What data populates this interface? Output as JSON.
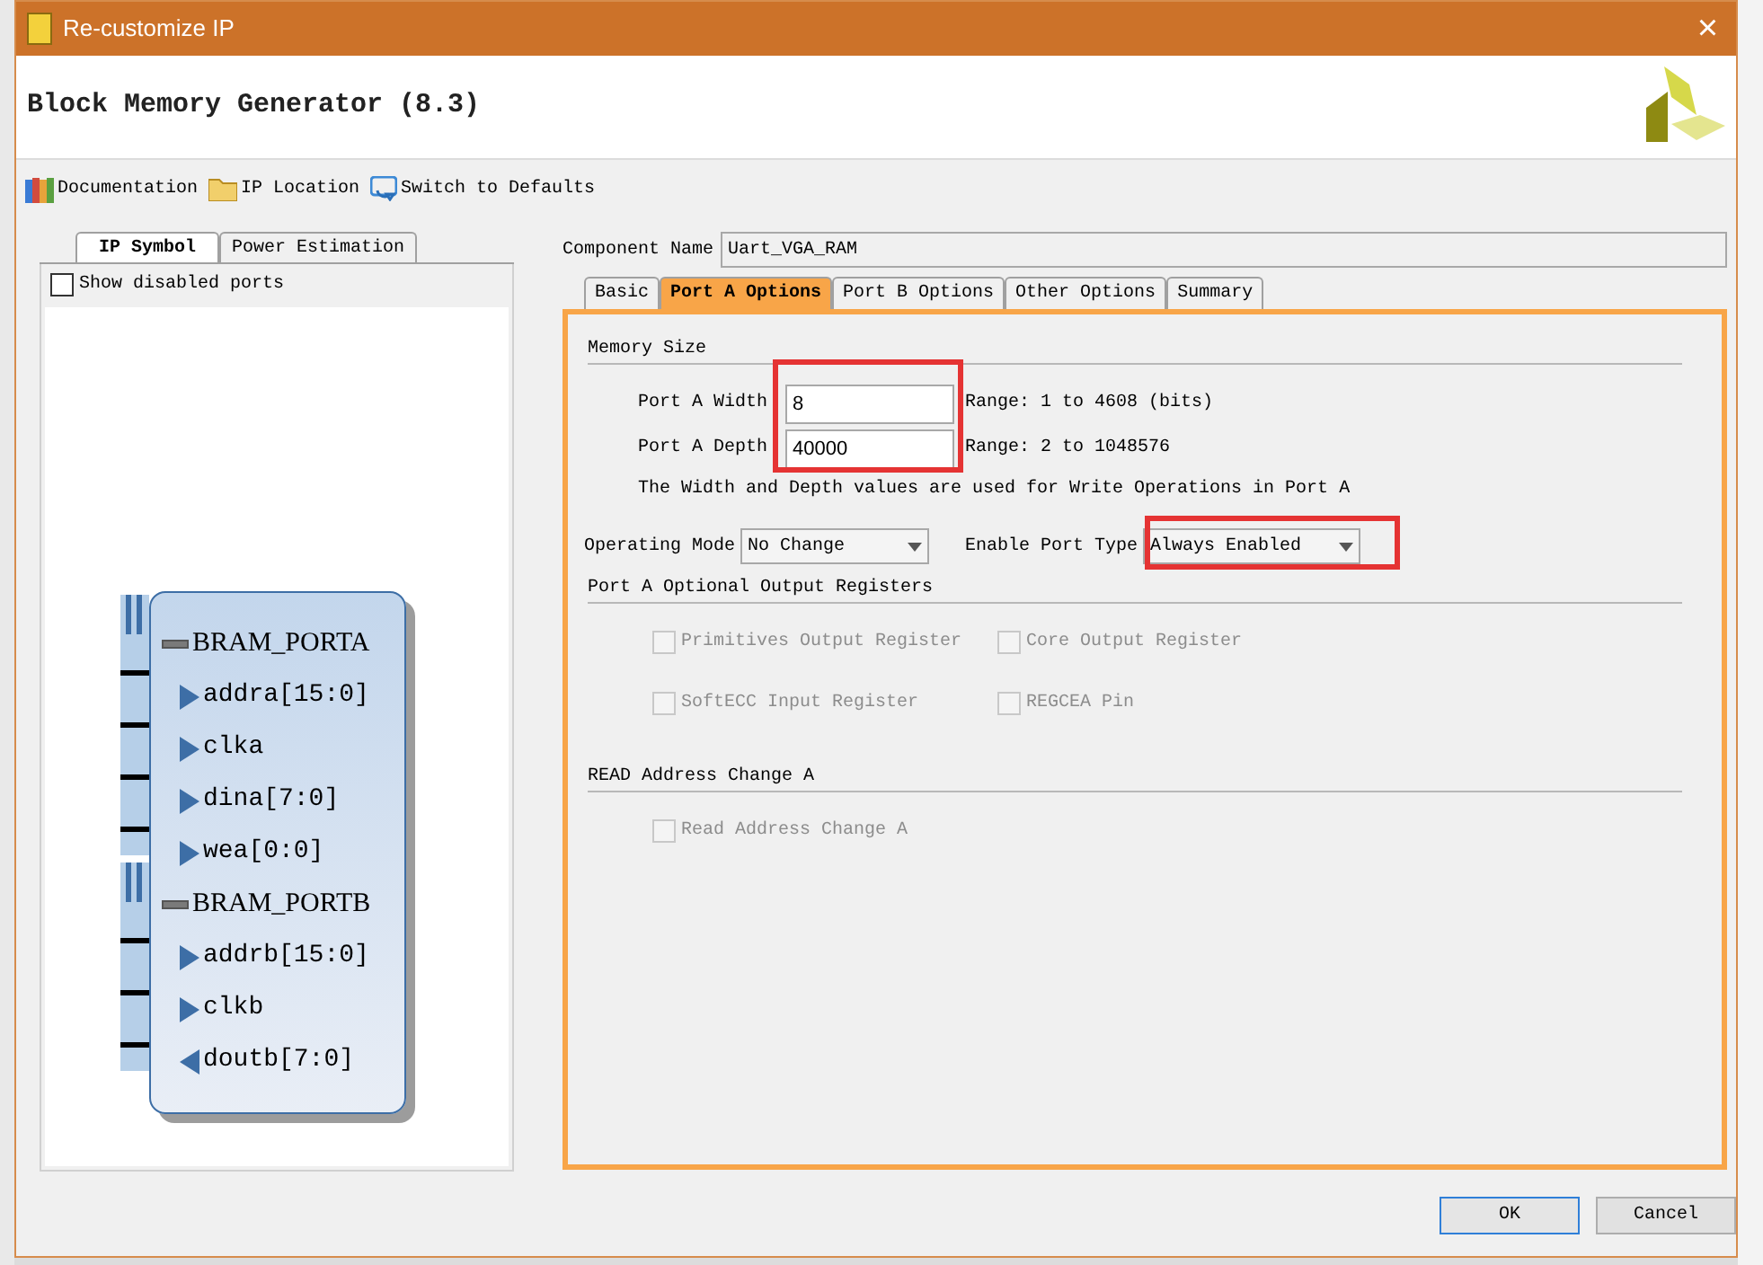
{
  "window": {
    "title": "Re-customize IP",
    "close": "×"
  },
  "header": {
    "title": "Block Memory Generator (8.3)"
  },
  "toolbar": [
    {
      "kind": "docs",
      "label": "Documentation"
    },
    {
      "kind": "folder",
      "label": "IP Location"
    },
    {
      "kind": "reset",
      "label": "Switch to Defaults"
    }
  ],
  "left_tabs": [
    {
      "label": "IP Symbol",
      "selected": true
    },
    {
      "label": "Power Estimation",
      "selected": false
    }
  ],
  "show_disabled_ports": {
    "label": "Show disabled ports",
    "checked": false
  },
  "ip_symbol": {
    "buses": [
      {
        "name": "BRAM_PORTA",
        "ports": [
          {
            "name": "addra[15:0]",
            "kind": "in"
          },
          {
            "name": "clka",
            "kind": "in"
          },
          {
            "name": "dina[7:0]",
            "kind": "in"
          },
          {
            "name": "wea[0:0]",
            "kind": "in"
          }
        ]
      },
      {
        "name": "BRAM_PORTB",
        "ports": [
          {
            "name": "addrb[15:0]",
            "kind": "in"
          },
          {
            "name": "clkb",
            "kind": "in"
          },
          {
            "name": "doutb[7:0]",
            "kind": "out"
          }
        ]
      }
    ]
  },
  "component_name": {
    "label": "Component Name",
    "value": "Uart_VGA_RAM"
  },
  "tabs": [
    {
      "label": "Basic",
      "selected": false
    },
    {
      "label": "Port A Options",
      "selected": true
    },
    {
      "label": "Port B Options",
      "selected": false
    },
    {
      "label": "Other Options",
      "selected": false
    },
    {
      "label": "Summary",
      "selected": false
    }
  ],
  "memory_size": {
    "title": "Memory Size",
    "fields": [
      {
        "label": "Port A Width",
        "value": "8",
        "range": "Range: 1 to 4608 (bits)"
      },
      {
        "label": "Port A Depth",
        "value": "40000",
        "range": "Range: 2 to 1048576"
      }
    ],
    "highlighted": true,
    "note": "The Width and Depth values are used for Write Operations in Port A"
  },
  "operating_mode": {
    "label": "Operating Mode",
    "value": "No Change",
    "highlighted": false
  },
  "enable_port_type": {
    "label": "Enable Port Type",
    "value": "Always Enabled",
    "highlighted": true
  },
  "output_registers": {
    "title": "Port A Optional Output Registers",
    "options": [
      {
        "label": "Primitives Output Register",
        "checked": false,
        "disabled": true
      },
      {
        "label": "Core Output Register",
        "checked": false,
        "disabled": true
      },
      {
        "label": "SoftECC Input Register",
        "checked": false,
        "disabled": true
      },
      {
        "label": "REGCEA Pin",
        "checked": false,
        "disabled": true
      }
    ]
  },
  "read_address_change": {
    "title": "READ Address Change A",
    "options": [
      {
        "label": "Read Address Change A",
        "checked": false,
        "disabled": true
      }
    ]
  },
  "buttons": [
    {
      "label": "OK",
      "default": true
    },
    {
      "label": "Cancel",
      "default": false
    }
  ]
}
